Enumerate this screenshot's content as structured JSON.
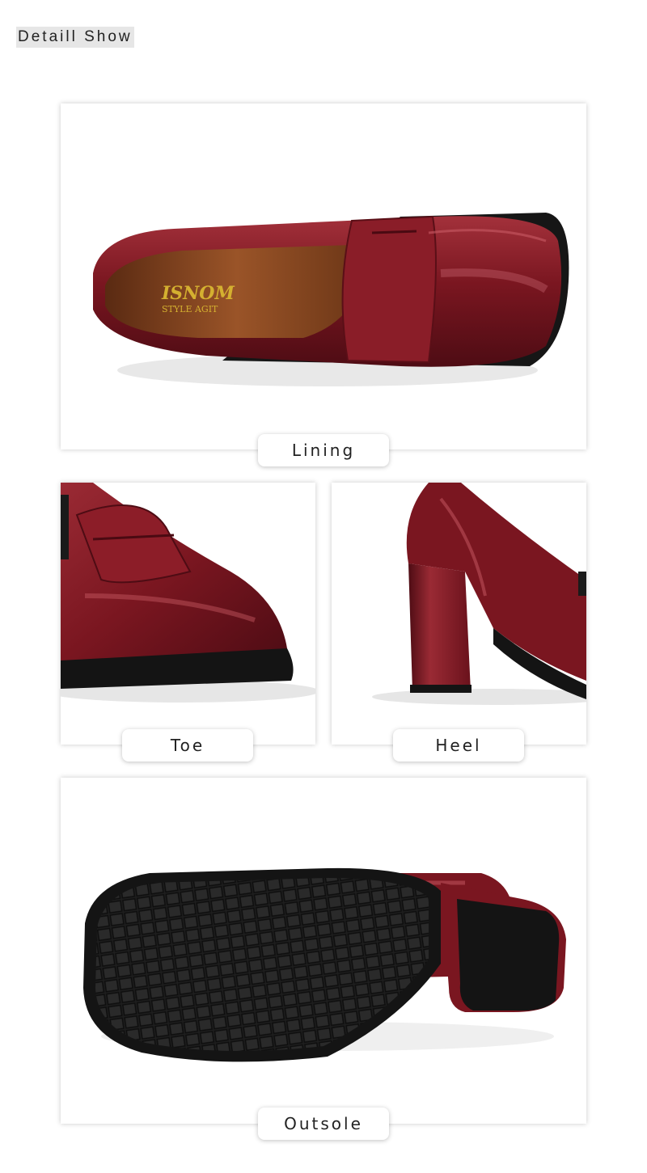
{
  "header": {
    "title": "Detaill Show"
  },
  "sections": {
    "lining": {
      "label": "Lining",
      "brand": "ISNOM",
      "brand_sub": "STYLE AGIT"
    },
    "toe": {
      "label": "Toe"
    },
    "heel": {
      "label": "Heel"
    },
    "outsole": {
      "label": "Outsole"
    }
  },
  "colors": {
    "patent": "#7a1620",
    "patent_dark": "#4e0c14",
    "sole": "#1c1c1c",
    "insole": "#8a4a24"
  }
}
